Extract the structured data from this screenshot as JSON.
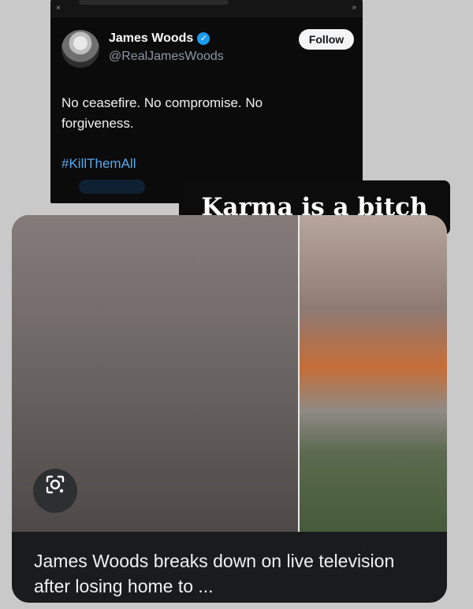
{
  "tweet": {
    "top_bar": {
      "close_glyph": "×",
      "more_glyph": "»"
    },
    "author_name": "James Woods",
    "verified_glyph": "✓",
    "handle": "@RealJamesWoods",
    "follow_label": "Follow",
    "text": "No ceasefire. No compromise. No forgiveness.",
    "hashtag": "#KillThemAll"
  },
  "caption": "Karma is a bitch",
  "news_card": {
    "headline": "James Woods breaks down on live television after losing home to ...",
    "lens_icon": "google-lens-icon"
  }
}
